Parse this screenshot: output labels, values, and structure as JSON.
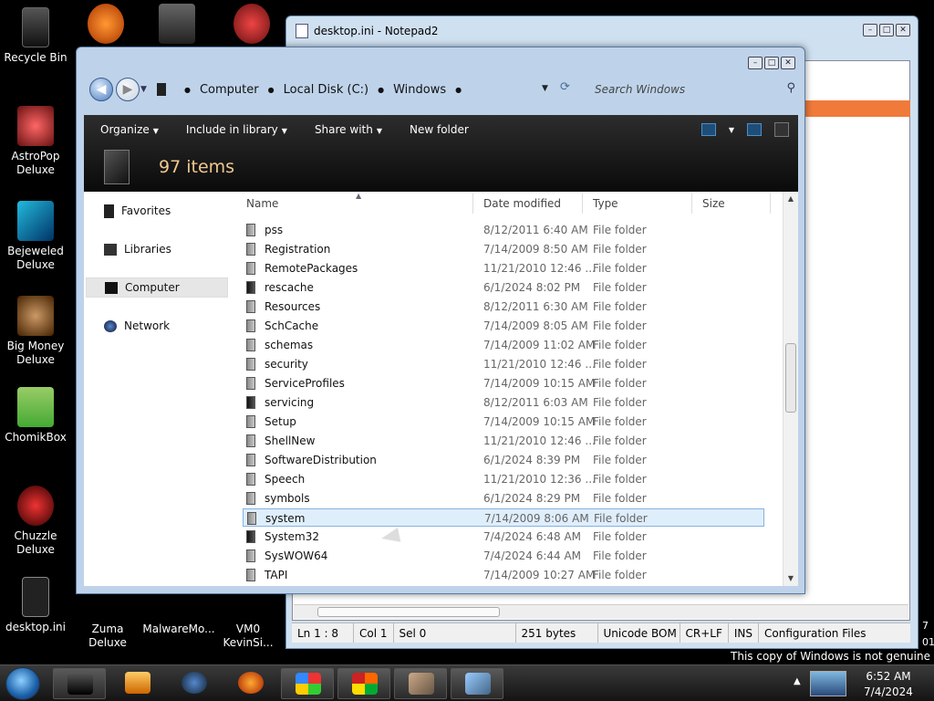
{
  "desktop": {
    "icons": [
      {
        "label": "Recycle Bin"
      },
      {
        "label": "AstroPop Deluxe"
      },
      {
        "label": "Bejeweled Deluxe"
      },
      {
        "label": "Big Money Deluxe"
      },
      {
        "label": "ChomikBox"
      },
      {
        "label": "Chuzzle Deluxe"
      },
      {
        "label": "desktop.ini"
      },
      {
        "label": "Zuma Deluxe"
      },
      {
        "label": "MalwareMo..."
      },
      {
        "label": "VM0 KevinSi..."
      }
    ],
    "genuine_notice": "This copy of Windows is not genuine",
    "clipped_text_1": "7",
    "clipped_text_2": "01"
  },
  "notepad": {
    "title": "desktop.ini - Notepad2",
    "status": {
      "position": "Ln 1 : 8",
      "col": "Col 1",
      "sel": "Sel 0",
      "size": "251 bytes",
      "encoding": "Unicode BOM",
      "eol": "CR+LF",
      "mode": "INS",
      "scheme": "Configuration Files"
    }
  },
  "explorer": {
    "address": {
      "crumbs": [
        "Computer",
        "Local Disk (C:)",
        "Windows"
      ],
      "search_placeholder": "Search Windows"
    },
    "toolbar": {
      "organize": "Organize",
      "include": "Include in library",
      "share": "Share with",
      "new_folder": "New folder"
    },
    "selection_count": "97 items",
    "nav": {
      "favorites": "Favorites",
      "libraries": "Libraries",
      "computer": "Computer",
      "network": "Network"
    },
    "columns": {
      "name": "Name",
      "date": "Date modified",
      "type": "Type",
      "size": "Size"
    },
    "files": [
      {
        "name": "pss",
        "date": "8/12/2011 6:40 AM",
        "type": "File folder"
      },
      {
        "name": "Registration",
        "date": "7/14/2009 8:50 AM",
        "type": "File folder"
      },
      {
        "name": "RemotePackages",
        "date": "11/21/2010 12:46 ...",
        "type": "File folder"
      },
      {
        "name": "rescache",
        "date": "6/1/2024 8:02 PM",
        "type": "File folder"
      },
      {
        "name": "Resources",
        "date": "8/12/2011 6:30 AM",
        "type": "File folder"
      },
      {
        "name": "SchCache",
        "date": "7/14/2009 8:05 AM",
        "type": "File folder"
      },
      {
        "name": "schemas",
        "date": "7/14/2009 11:02 AM",
        "type": "File folder"
      },
      {
        "name": "security",
        "date": "11/21/2010 12:46 ...",
        "type": "File folder"
      },
      {
        "name": "ServiceProfiles",
        "date": "7/14/2009 10:15 AM",
        "type": "File folder"
      },
      {
        "name": "servicing",
        "date": "8/12/2011 6:03 AM",
        "type": "File folder"
      },
      {
        "name": "Setup",
        "date": "7/14/2009 10:15 AM",
        "type": "File folder"
      },
      {
        "name": "ShellNew",
        "date": "11/21/2010 12:46 ...",
        "type": "File folder"
      },
      {
        "name": "SoftwareDistribution",
        "date": "6/1/2024 8:39 PM",
        "type": "File folder"
      },
      {
        "name": "Speech",
        "date": "11/21/2010 12:36 ...",
        "type": "File folder"
      },
      {
        "name": "symbols",
        "date": "6/1/2024 8:29 PM",
        "type": "File folder"
      },
      {
        "name": "system",
        "date": "7/14/2009 8:06 AM",
        "type": "File folder"
      },
      {
        "name": "System32",
        "date": "7/4/2024 6:48 AM",
        "type": "File folder"
      },
      {
        "name": "SysWOW64",
        "date": "7/4/2024 6:44 AM",
        "type": "File folder"
      },
      {
        "name": "TAPI",
        "date": "7/14/2009 10:27 AM",
        "type": "File folder"
      }
    ]
  },
  "taskbar": {
    "time": "6:52 AM",
    "date": "7/4/2024"
  }
}
